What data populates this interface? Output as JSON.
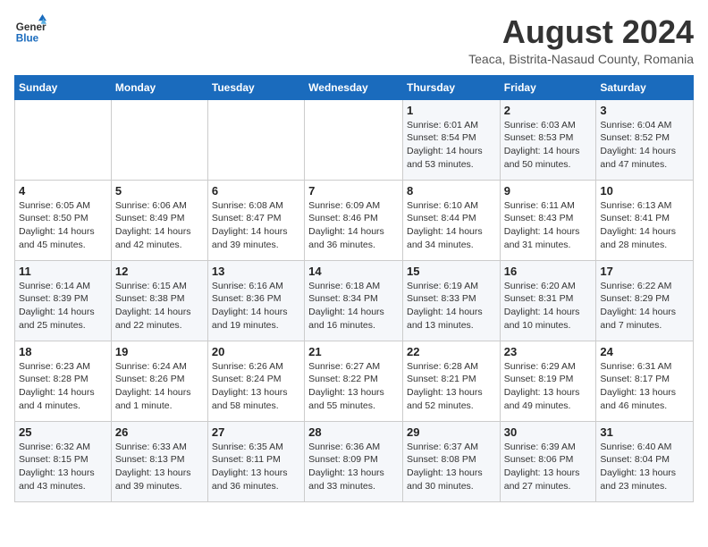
{
  "logo": {
    "line1": "General",
    "line2": "Blue"
  },
  "title": "August 2024",
  "subtitle": "Teaca, Bistrita-Nasaud County, Romania",
  "days_of_week": [
    "Sunday",
    "Monday",
    "Tuesday",
    "Wednesday",
    "Thursday",
    "Friday",
    "Saturday"
  ],
  "weeks": [
    [
      {
        "day": "",
        "info": ""
      },
      {
        "day": "",
        "info": ""
      },
      {
        "day": "",
        "info": ""
      },
      {
        "day": "",
        "info": ""
      },
      {
        "day": "1",
        "info": "Sunrise: 6:01 AM\nSunset: 8:54 PM\nDaylight: 14 hours and 53 minutes."
      },
      {
        "day": "2",
        "info": "Sunrise: 6:03 AM\nSunset: 8:53 PM\nDaylight: 14 hours and 50 minutes."
      },
      {
        "day": "3",
        "info": "Sunrise: 6:04 AM\nSunset: 8:52 PM\nDaylight: 14 hours and 47 minutes."
      }
    ],
    [
      {
        "day": "4",
        "info": "Sunrise: 6:05 AM\nSunset: 8:50 PM\nDaylight: 14 hours and 45 minutes."
      },
      {
        "day": "5",
        "info": "Sunrise: 6:06 AM\nSunset: 8:49 PM\nDaylight: 14 hours and 42 minutes."
      },
      {
        "day": "6",
        "info": "Sunrise: 6:08 AM\nSunset: 8:47 PM\nDaylight: 14 hours and 39 minutes."
      },
      {
        "day": "7",
        "info": "Sunrise: 6:09 AM\nSunset: 8:46 PM\nDaylight: 14 hours and 36 minutes."
      },
      {
        "day": "8",
        "info": "Sunrise: 6:10 AM\nSunset: 8:44 PM\nDaylight: 14 hours and 34 minutes."
      },
      {
        "day": "9",
        "info": "Sunrise: 6:11 AM\nSunset: 8:43 PM\nDaylight: 14 hours and 31 minutes."
      },
      {
        "day": "10",
        "info": "Sunrise: 6:13 AM\nSunset: 8:41 PM\nDaylight: 14 hours and 28 minutes."
      }
    ],
    [
      {
        "day": "11",
        "info": "Sunrise: 6:14 AM\nSunset: 8:39 PM\nDaylight: 14 hours and 25 minutes."
      },
      {
        "day": "12",
        "info": "Sunrise: 6:15 AM\nSunset: 8:38 PM\nDaylight: 14 hours and 22 minutes."
      },
      {
        "day": "13",
        "info": "Sunrise: 6:16 AM\nSunset: 8:36 PM\nDaylight: 14 hours and 19 minutes."
      },
      {
        "day": "14",
        "info": "Sunrise: 6:18 AM\nSunset: 8:34 PM\nDaylight: 14 hours and 16 minutes."
      },
      {
        "day": "15",
        "info": "Sunrise: 6:19 AM\nSunset: 8:33 PM\nDaylight: 14 hours and 13 minutes."
      },
      {
        "day": "16",
        "info": "Sunrise: 6:20 AM\nSunset: 8:31 PM\nDaylight: 14 hours and 10 minutes."
      },
      {
        "day": "17",
        "info": "Sunrise: 6:22 AM\nSunset: 8:29 PM\nDaylight: 14 hours and 7 minutes."
      }
    ],
    [
      {
        "day": "18",
        "info": "Sunrise: 6:23 AM\nSunset: 8:28 PM\nDaylight: 14 hours and 4 minutes."
      },
      {
        "day": "19",
        "info": "Sunrise: 6:24 AM\nSunset: 8:26 PM\nDaylight: 14 hours and 1 minute."
      },
      {
        "day": "20",
        "info": "Sunrise: 6:26 AM\nSunset: 8:24 PM\nDaylight: 13 hours and 58 minutes."
      },
      {
        "day": "21",
        "info": "Sunrise: 6:27 AM\nSunset: 8:22 PM\nDaylight: 13 hours and 55 minutes."
      },
      {
        "day": "22",
        "info": "Sunrise: 6:28 AM\nSunset: 8:21 PM\nDaylight: 13 hours and 52 minutes."
      },
      {
        "day": "23",
        "info": "Sunrise: 6:29 AM\nSunset: 8:19 PM\nDaylight: 13 hours and 49 minutes."
      },
      {
        "day": "24",
        "info": "Sunrise: 6:31 AM\nSunset: 8:17 PM\nDaylight: 13 hours and 46 minutes."
      }
    ],
    [
      {
        "day": "25",
        "info": "Sunrise: 6:32 AM\nSunset: 8:15 PM\nDaylight: 13 hours and 43 minutes."
      },
      {
        "day": "26",
        "info": "Sunrise: 6:33 AM\nSunset: 8:13 PM\nDaylight: 13 hours and 39 minutes."
      },
      {
        "day": "27",
        "info": "Sunrise: 6:35 AM\nSunset: 8:11 PM\nDaylight: 13 hours and 36 minutes."
      },
      {
        "day": "28",
        "info": "Sunrise: 6:36 AM\nSunset: 8:09 PM\nDaylight: 13 hours and 33 minutes."
      },
      {
        "day": "29",
        "info": "Sunrise: 6:37 AM\nSunset: 8:08 PM\nDaylight: 13 hours and 30 minutes."
      },
      {
        "day": "30",
        "info": "Sunrise: 6:39 AM\nSunset: 8:06 PM\nDaylight: 13 hours and 27 minutes."
      },
      {
        "day": "31",
        "info": "Sunrise: 6:40 AM\nSunset: 8:04 PM\nDaylight: 13 hours and 23 minutes."
      }
    ]
  ]
}
